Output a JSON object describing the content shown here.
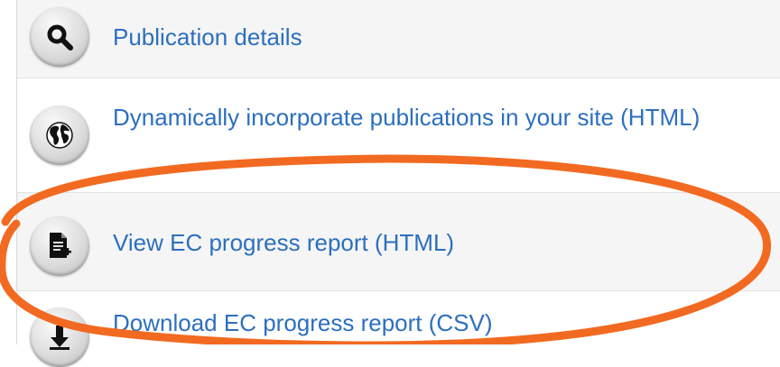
{
  "items": [
    {
      "label": "Publication details",
      "icon": "magnifier-icon"
    },
    {
      "label": "Dynamically incorporate publications in your site (HTML)",
      "icon": "globe-icon"
    },
    {
      "label": "View EC progress report (HTML)",
      "icon": "document-add-icon"
    },
    {
      "label": "Download EC progress report (CSV)",
      "icon": "download-arrow-icon"
    }
  ],
  "colors": {
    "link": "#2c6fbe",
    "highlight": "#f26a21",
    "row_alt": "#f5f5f5"
  }
}
